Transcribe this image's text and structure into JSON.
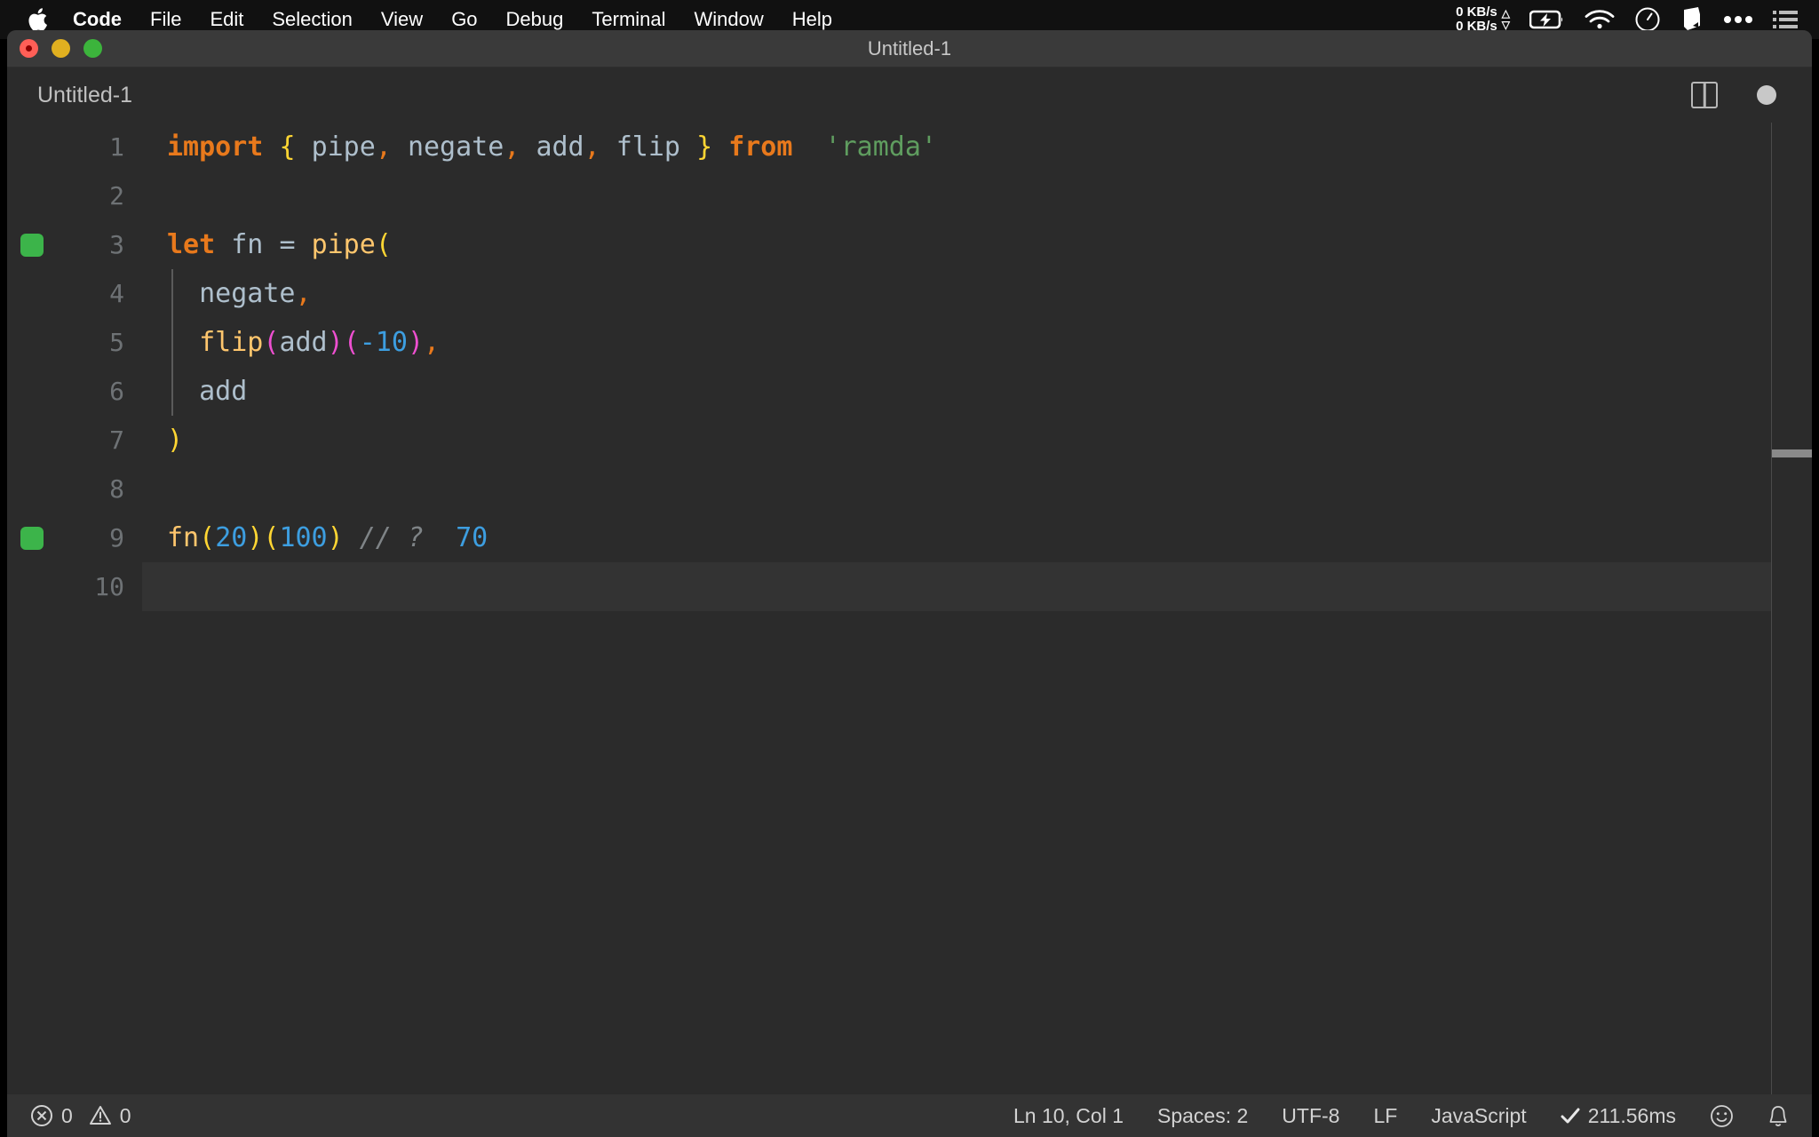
{
  "menubar": {
    "apple_icon": "apple-logo-icon",
    "items": [
      {
        "label": "Code",
        "bold": true
      },
      {
        "label": "File",
        "bold": false
      },
      {
        "label": "Edit",
        "bold": false
      },
      {
        "label": "Selection",
        "bold": false
      },
      {
        "label": "View",
        "bold": false
      },
      {
        "label": "Go",
        "bold": false
      },
      {
        "label": "Debug",
        "bold": false
      },
      {
        "label": "Terminal",
        "bold": false
      },
      {
        "label": "Window",
        "bold": false
      },
      {
        "label": "Help",
        "bold": false
      }
    ],
    "network": {
      "upload": "0 KB/s",
      "download": "0 KB/s",
      "up_arrow": "triangle-up-icon",
      "down_arrow": "triangle-down-icon"
    },
    "status_icons": [
      "battery-charging-icon",
      "wifi-icon",
      "clock-icon",
      "dropbox-icon",
      "ellipsis-icon",
      "control-center-list-icon"
    ]
  },
  "window": {
    "title": "Untitled-1",
    "traffic_lights": [
      "close-button",
      "minimize-button",
      "maximize-button"
    ]
  },
  "tabbar": {
    "tab_label": "Untitled-1",
    "split_editor_icon": "split-editor-icon",
    "dirty_indicator": "unsaved-changes-dot"
  },
  "editor": {
    "language": "JavaScript",
    "lines": [
      {
        "number": "1",
        "breakpoint": false,
        "active": false,
        "indent_guide": false,
        "tokens": [
          {
            "text": "import",
            "cls": "t-kw"
          },
          {
            "text": " ",
            "cls": "t-var"
          },
          {
            "text": "{",
            "cls": "t-brace"
          },
          {
            "text": " ",
            "cls": "t-var"
          },
          {
            "text": "pipe",
            "cls": "t-var"
          },
          {
            "text": ",",
            "cls": "t-comma"
          },
          {
            "text": " ",
            "cls": "t-var"
          },
          {
            "text": "negate",
            "cls": "t-var"
          },
          {
            "text": ",",
            "cls": "t-comma"
          },
          {
            "text": " ",
            "cls": "t-var"
          },
          {
            "text": "add",
            "cls": "t-var"
          },
          {
            "text": ",",
            "cls": "t-comma"
          },
          {
            "text": " ",
            "cls": "t-var"
          },
          {
            "text": "flip",
            "cls": "t-var"
          },
          {
            "text": " ",
            "cls": "t-var"
          },
          {
            "text": "}",
            "cls": "t-brace"
          },
          {
            "text": " ",
            "cls": "t-var"
          },
          {
            "text": "from",
            "cls": "t-kw"
          },
          {
            "text": "  ",
            "cls": "t-var"
          },
          {
            "text": "'ramda'",
            "cls": "t-str"
          }
        ]
      },
      {
        "number": "2",
        "breakpoint": false,
        "active": false,
        "indent_guide": false,
        "tokens": []
      },
      {
        "number": "3",
        "breakpoint": true,
        "active": false,
        "indent_guide": false,
        "tokens": [
          {
            "text": "let",
            "cls": "t-kw"
          },
          {
            "text": " ",
            "cls": "t-var"
          },
          {
            "text": "fn",
            "cls": "t-var"
          },
          {
            "text": " ",
            "cls": "t-var"
          },
          {
            "text": "=",
            "cls": "t-op"
          },
          {
            "text": " ",
            "cls": "t-var"
          },
          {
            "text": "pipe",
            "cls": "t-fn"
          },
          {
            "text": "(",
            "cls": "t-paren-y"
          }
        ]
      },
      {
        "number": "4",
        "breakpoint": false,
        "active": false,
        "indent_guide": true,
        "tokens": [
          {
            "text": "  ",
            "cls": "t-var"
          },
          {
            "text": "negate",
            "cls": "t-var"
          },
          {
            "text": ",",
            "cls": "t-comma"
          }
        ]
      },
      {
        "number": "5",
        "breakpoint": false,
        "active": false,
        "indent_guide": true,
        "tokens": [
          {
            "text": "  ",
            "cls": "t-var"
          },
          {
            "text": "flip",
            "cls": "t-fn"
          },
          {
            "text": "(",
            "cls": "t-paren-m"
          },
          {
            "text": "add",
            "cls": "t-var"
          },
          {
            "text": ")",
            "cls": "t-paren-m"
          },
          {
            "text": "(",
            "cls": "t-paren-m"
          },
          {
            "text": "-10",
            "cls": "t-num"
          },
          {
            "text": ")",
            "cls": "t-paren-m"
          },
          {
            "text": ",",
            "cls": "t-comma"
          }
        ]
      },
      {
        "number": "6",
        "breakpoint": false,
        "active": false,
        "indent_guide": true,
        "tokens": [
          {
            "text": "  ",
            "cls": "t-var"
          },
          {
            "text": "add",
            "cls": "t-var"
          }
        ]
      },
      {
        "number": "7",
        "breakpoint": false,
        "active": false,
        "indent_guide": false,
        "tokens": [
          {
            "text": ")",
            "cls": "t-paren-y"
          }
        ]
      },
      {
        "number": "8",
        "breakpoint": false,
        "active": false,
        "indent_guide": false,
        "tokens": []
      },
      {
        "number": "9",
        "breakpoint": true,
        "active": false,
        "indent_guide": false,
        "tokens": [
          {
            "text": "fn",
            "cls": "t-fn"
          },
          {
            "text": "(",
            "cls": "t-paren-y"
          },
          {
            "text": "20",
            "cls": "t-num"
          },
          {
            "text": ")",
            "cls": "t-paren-y"
          },
          {
            "text": "(",
            "cls": "t-paren-y"
          },
          {
            "text": "100",
            "cls": "t-num"
          },
          {
            "text": ")",
            "cls": "t-paren-y"
          },
          {
            "text": " ",
            "cls": "t-var"
          },
          {
            "text": "// ?",
            "cls": "t-comment"
          },
          {
            "text": "  ",
            "cls": "t-var"
          },
          {
            "text": "70",
            "cls": "t-num"
          }
        ]
      },
      {
        "number": "10",
        "breakpoint": false,
        "active": true,
        "indent_guide": false,
        "tokens": []
      }
    ]
  },
  "statusbar": {
    "errors_icon": "error-circle-icon",
    "errors_count": "0",
    "warnings_icon": "warning-triangle-icon",
    "warnings_count": "0",
    "cursor_position": "Ln 10, Col 1",
    "indentation": "Spaces: 2",
    "encoding": "UTF-8",
    "eol": "LF",
    "language_mode": "JavaScript",
    "run_time": "211.56ms",
    "run_check_icon": "checkmark-icon",
    "feedback_icon": "smiley-icon",
    "notifications_icon": "bell-icon"
  },
  "colors": {
    "editor_bg": "#2b2b2b",
    "titlebar_bg": "#3a3a3a",
    "statusbar_bg": "#333333",
    "breakpoint_green": "#3cb44a",
    "keyword_orange": "#e8791c",
    "string_green": "#5f9d5f",
    "number_blue": "#3d9ee0",
    "function_amber": "#ffc66d",
    "bracket_yellow": "#ffd633",
    "bracket_magenta": "#ee4fd0",
    "identifier_gray": "#aebfcc",
    "comment_gray": "#7f8487",
    "linenumber_gray": "#6e7275"
  }
}
